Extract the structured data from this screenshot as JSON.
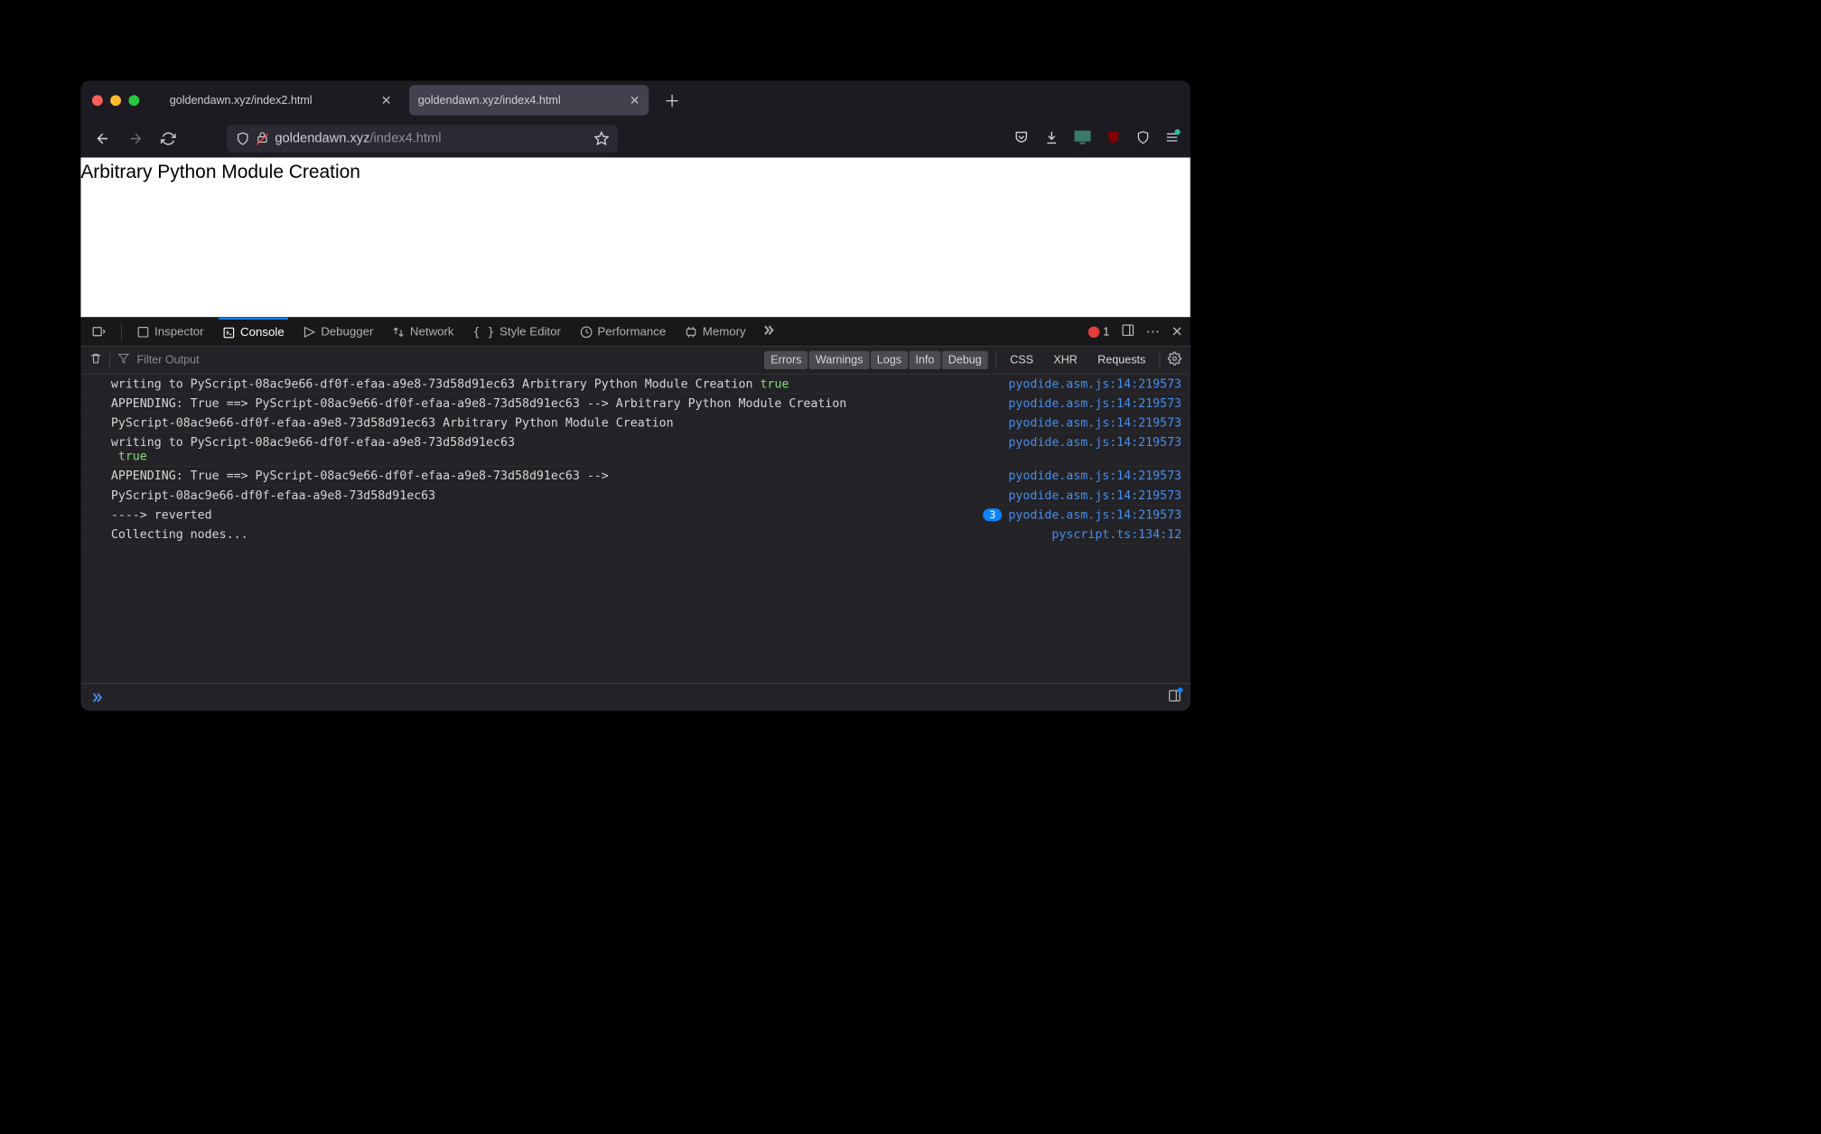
{
  "tabs": [
    {
      "title": "goldendawn.xyz/index2.html",
      "active": false
    },
    {
      "title": "goldendawn.xyz/index4.html",
      "active": true
    }
  ],
  "url": {
    "host": "goldendawn.xyz",
    "path": "/index4.html"
  },
  "page": {
    "heading": "Arbitrary Python Module Creation"
  },
  "devtools": {
    "tabs": [
      "Inspector",
      "Console",
      "Debugger",
      "Network",
      "Style Editor",
      "Performance",
      "Memory"
    ],
    "activeTab": "Console",
    "errorCount": "1",
    "filterPlaceholder": "Filter Output",
    "levelChips": [
      "Errors",
      "Warnings",
      "Logs",
      "Info",
      "Debug"
    ],
    "networkChips": [
      "CSS",
      "XHR",
      "Requests"
    ],
    "messages": [
      {
        "text": "writing to PyScript-08ac9e66-df0f-efaa-a9e8-73d58d91ec63 Arbitrary Python Module Creation ",
        "green": "true",
        "src": "pyodide.asm.js:14:219573"
      },
      {
        "text": "APPENDING: True ==> PyScript-08ac9e66-df0f-efaa-a9e8-73d58d91ec63 --> Arbitrary Python Module Creation",
        "src": "pyodide.asm.js:14:219573"
      },
      {
        "text": "PyScript-08ac9e66-df0f-efaa-a9e8-73d58d91ec63 Arbitrary Python Module Creation",
        "src": "pyodide.asm.js:14:219573"
      },
      {
        "text": "writing to PyScript-08ac9e66-df0f-efaa-a9e8-73d58d91ec63\n ",
        "green": "true",
        "src": "pyodide.asm.js:14:219573"
      },
      {
        "text": "APPENDING: True ==> PyScript-08ac9e66-df0f-efaa-a9e8-73d58d91ec63 -->",
        "src": "pyodide.asm.js:14:219573"
      },
      {
        "text": "PyScript-08ac9e66-df0f-efaa-a9e8-73d58d91ec63",
        "src": "pyodide.asm.js:14:219573"
      },
      {
        "text": "----> reverted",
        "count": "3",
        "src": "pyodide.asm.js:14:219573"
      },
      {
        "text": "Collecting nodes...",
        "src": "pyscript.ts:134:12"
      }
    ]
  }
}
